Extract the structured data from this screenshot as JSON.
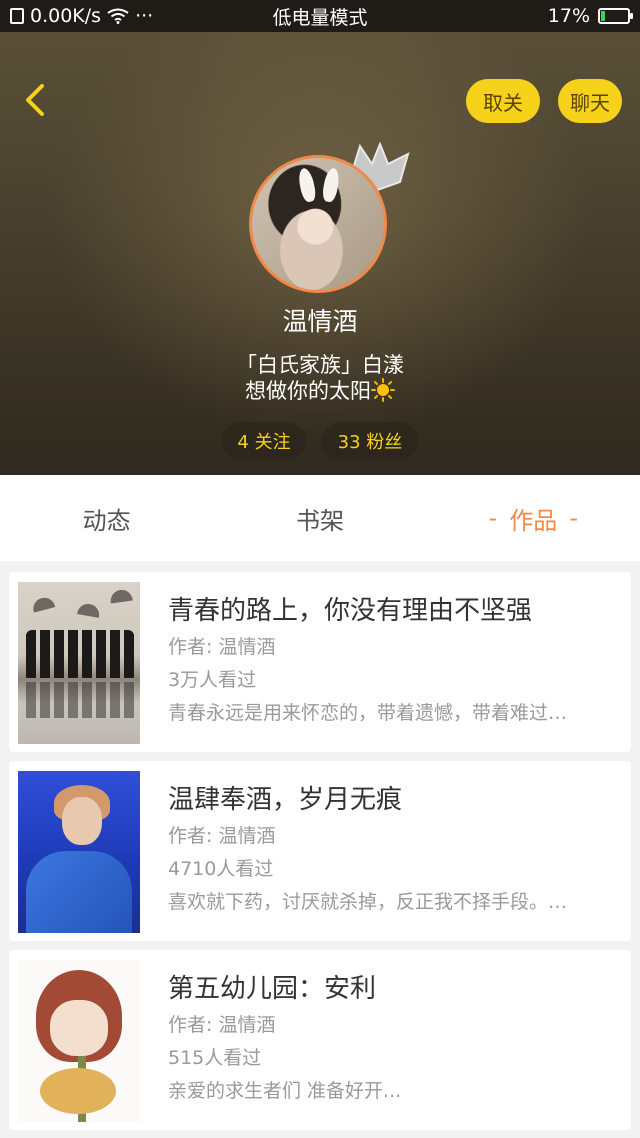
{
  "status_bar": {
    "net_speed": "0.00K/s",
    "more": "···",
    "mode": "低电量模式",
    "battery_pct": "17%",
    "battery_level": 0.17
  },
  "header": {
    "unfollow_label": "取关",
    "chat_label": "聊天",
    "username": "温情酒",
    "bio_line1": "「白氏家族」白漾",
    "bio_line2": "想做你的太阳",
    "following": "4 关注",
    "fans": "33 粉丝"
  },
  "tabs": [
    {
      "label": "动态",
      "active": false
    },
    {
      "label": "书架",
      "active": false
    },
    {
      "label": "作品",
      "active": true,
      "decor_left": "-",
      "decor_right": "-"
    }
  ],
  "works": [
    {
      "title": "青春的路上，你没有理由不坚强",
      "author": "作者: 温情酒",
      "views": "3万人看过",
      "summary": "青春永远是用来怀恋的，带着遗憾，带着难过…"
    },
    {
      "title": "温肆奉酒，岁月无痕",
      "author": "作者: 温情酒",
      "views": "4710人看过",
      "summary": "喜欢就下药，讨厌就杀掉，反正我不择手段。…"
    },
    {
      "title": "第五幼儿园：安利",
      "author": "作者: 温情酒",
      "views": "515人看过",
      "summary": "亲爱的求生者们 准备好开..."
    }
  ],
  "colors": {
    "accent": "#f08a4a",
    "pill": "#f7d21a",
    "stat_text": "#f7d21a"
  }
}
